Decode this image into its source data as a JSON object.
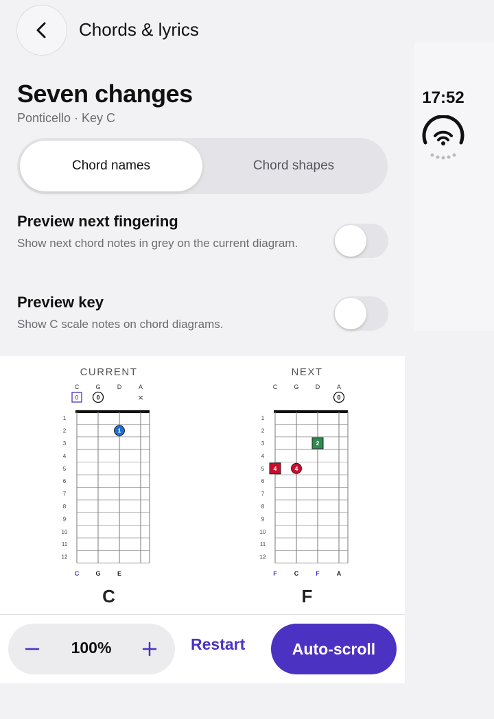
{
  "header": {
    "title": "Chords & lyrics",
    "back_icon": "chevron-left-icon"
  },
  "status": {
    "time": "17:52",
    "wifi_icon": "wifi-icon"
  },
  "song": {
    "title": "Seven changes",
    "meta": "Ponticello · Key C"
  },
  "view_toggle": {
    "options": [
      "Chord names",
      "Chord shapes"
    ],
    "selected": "Chord names"
  },
  "settings": [
    {
      "title": "Preview next fingering",
      "description": "Show next chord notes in grey on the current diagram.",
      "enabled": false
    },
    {
      "title": "Preview key",
      "description": "Show C scale notes on chord diagrams.",
      "enabled": false
    }
  ],
  "diagrams": {
    "current": {
      "heading": "CURRENT",
      "strings": [
        "C",
        "G",
        "D",
        "A"
      ],
      "open_markers": [
        "0",
        "0",
        "",
        "×"
      ],
      "fingers": [
        {
          "string": 2,
          "fret": 2,
          "label": "1",
          "shape": "circle",
          "color": "#1f6fd1"
        }
      ],
      "bottom_notes": [
        "C",
        "G",
        "E",
        ""
      ],
      "chord": "C"
    },
    "next": {
      "heading": "NEXT",
      "strings": [
        "C",
        "G",
        "D",
        "A"
      ],
      "open_markers": [
        "",
        "",
        "",
        "0"
      ],
      "fingers": [
        {
          "string": 2,
          "fret": 3,
          "label": "2",
          "shape": "square",
          "color": "#2e8b4f"
        },
        {
          "string": 0,
          "fret": 5,
          "label": "4",
          "shape": "square",
          "color": "#c8102e"
        },
        {
          "string": 1,
          "fret": 5,
          "label": "4",
          "shape": "circle",
          "color": "#c8102e"
        }
      ],
      "bottom_notes": [
        "F",
        "C",
        "F",
        "A"
      ],
      "chord": "F"
    },
    "fret_numbers": [
      "1",
      "2",
      "3",
      "4",
      "5",
      "6",
      "7",
      "8",
      "9",
      "10",
      "11",
      "12"
    ],
    "colors": {
      "key_note": "#4b32c3",
      "ink": "#222222",
      "grid": "#999999"
    }
  },
  "controls": {
    "zoom": "100%",
    "minus_icon": "minus-icon",
    "plus_icon": "plus-icon",
    "restart_label": "Restart",
    "autoscroll_label": "Auto-scroll",
    "accent": "#4b32c3"
  }
}
